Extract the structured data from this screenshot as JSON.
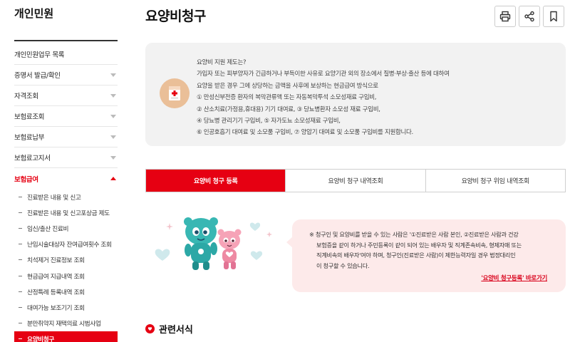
{
  "sidebar": {
    "title": "개인민원",
    "items": [
      {
        "label": "개인민원업무 목록",
        "caret": false
      },
      {
        "label": "증명서 발급/확인",
        "caret": true
      },
      {
        "label": "자격조회",
        "caret": true
      },
      {
        "label": "보험료조회",
        "caret": true
      },
      {
        "label": "보험료납부",
        "caret": true
      },
      {
        "label": "보험료고지서",
        "caret": true
      }
    ],
    "active_section": "보험급여",
    "sub_items": [
      "진료받은 내용 및 신고",
      "진료받은 내용 및 신고포상금 제도",
      "임신/출산 진료비",
      "난임시술대상자 잔여급여횟수 조회",
      "치석제거 진료정보 조회",
      "현금급여 지급내역 조회",
      "산정특례 등록내역 조회",
      "대여가능 보조기기 조회",
      "분만취약지 재택의료 시범사업",
      "요양비청구"
    ]
  },
  "header": {
    "title": "요양비청구",
    "buttons": [
      "print-icon",
      "share-icon",
      "bookmark-icon"
    ]
  },
  "info": {
    "icon": "medical-document-icon",
    "lines": [
      "요양비 지원 제도는?",
      "가입자 또는 피부양자가 긴급하거나 부득이한 사유로 요양기관 외의 장소에서 질병·부상·출산 등에 대하여",
      "요양을 받은 경우 그에 상당하는 금액을 사후에 보상하는 현금급여 방식으로",
      "① 만성신부전증 환자의 복막관류액 또는 자동복막투석 소모성재료 구입비,",
      "② 산소치료(가정용,휴대용) 기기 대여료, ③ 당뇨병환자 소모성 재료 구입비,",
      "④ 당뇨병 관리기기 구입비, ⑤ 자가도뇨 소모성재료 구입비,",
      "⑥ 인공호흡기 대여료 및 소모품 구입비, ⑦ 양압기 대여료 및 소모품 구입비를 지원합니다."
    ]
  },
  "tabs": [
    {
      "label": "요양비 청구 등록",
      "active": true
    },
    {
      "label": "요양비 청구 내역조회",
      "active": false
    },
    {
      "label": "요양비 청구 위임 내역조회",
      "active": false
    }
  ],
  "notice": {
    "lines": [
      "※ 청구인 및 요양비를 받을 수 있는 사람은 '①진료받은 사람 본인, ②진료받은 사람과 건강",
      "보험증을 같이 하거나 주민등록이 같이 되어 있는 배우자 및 직계존속비속, 형제자매 또는",
      "직계비속의 배우자'여야 하며, 청구인(진료받은 사람)이 제한능력자일 경우 법정대리인",
      "이 청구할 수 있습니다."
    ],
    "link": "'요양비 청구등록' 바로가기"
  },
  "related": {
    "title": "관련서식"
  },
  "colors": {
    "accent": "#e60012",
    "info_bg": "#f2f2f2",
    "notice_bg": "#fdeaea"
  }
}
